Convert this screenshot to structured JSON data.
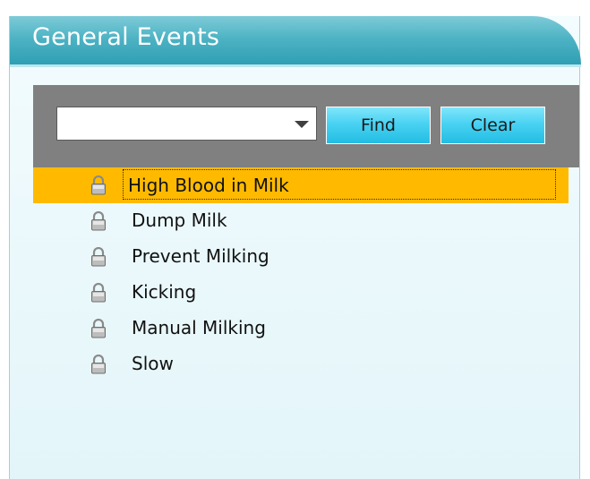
{
  "header": {
    "title": "General Events"
  },
  "search": {
    "value": "",
    "find_label": "Find",
    "clear_label": "Clear"
  },
  "events": [
    {
      "label": "High Blood in Milk",
      "selected": true
    },
    {
      "label": "Dump Milk",
      "selected": false
    },
    {
      "label": "Prevent Milking",
      "selected": false
    },
    {
      "label": "Kicking",
      "selected": false
    },
    {
      "label": "Manual Milking",
      "selected": false
    },
    {
      "label": "Slow",
      "selected": false
    }
  ],
  "icons": {
    "row_icon": "lock-icon"
  },
  "colors": {
    "header_teal": "#2f9fb3",
    "search_bar_gray": "#808080",
    "button_cyan": "#49d2f2",
    "selection_orange": "#ffba00"
  }
}
